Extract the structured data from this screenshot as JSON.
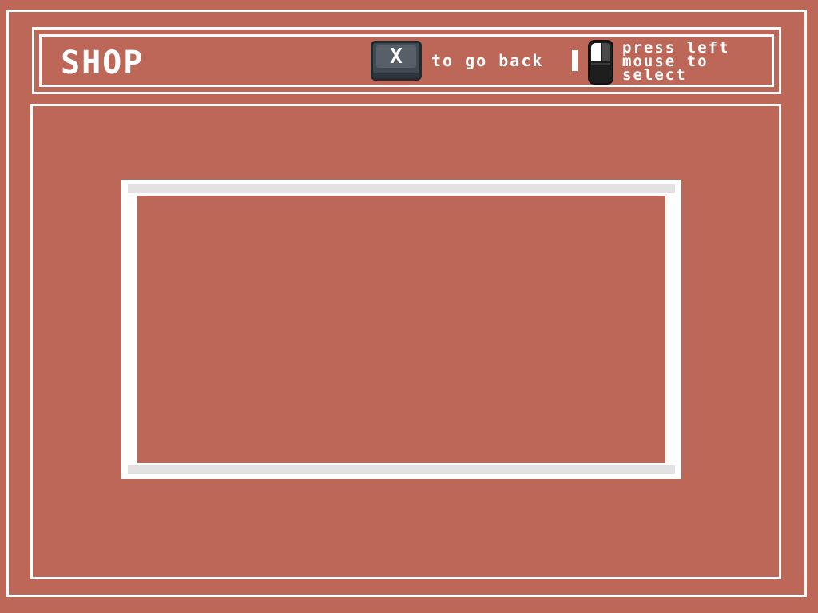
{
  "header": {
    "title": "SHOP",
    "back_key": "X",
    "back_hint": "to go back",
    "select_hint_lines": [
      "press left",
      "mouse to",
      "select"
    ]
  },
  "icons": {
    "back_key_icon": "x-key-icon",
    "mouse_icon": "left-mouse-button-icon"
  },
  "colors": {
    "background": "#bc6758",
    "frame": "#ffffff",
    "key": "#3f4a52",
    "mouse": "#1e1e1e"
  }
}
